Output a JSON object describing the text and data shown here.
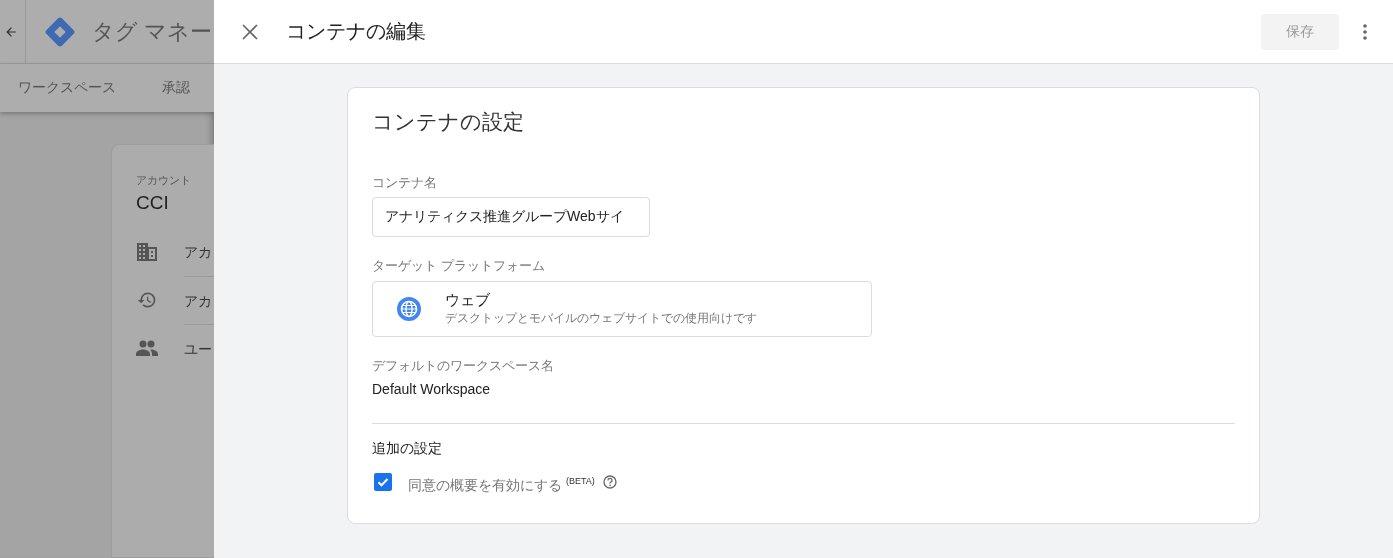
{
  "background": {
    "app_title": "タグ マネー",
    "nav_tabs": [
      {
        "label": "ワークスペース",
        "selected": false
      },
      {
        "label": "承認",
        "selected": false
      }
    ],
    "account": {
      "caption": "アカウント",
      "name": "CCI",
      "items": [
        {
          "kind": "building",
          "label": "アカ"
        },
        {
          "kind": "history",
          "label": "アカ"
        },
        {
          "kind": "people",
          "label": "ユー"
        }
      ]
    }
  },
  "panel": {
    "title": "コンテナの編集",
    "save_button": {
      "label": "保存",
      "disabled": true
    },
    "card": {
      "title": "コンテナの設定",
      "container_name": {
        "label": "コンテナ名",
        "value": "アナリティクス推進グループWebサイ"
      },
      "platform": {
        "label": "ターゲット プラットフォーム",
        "name": "ウェブ",
        "description": "デスクトップとモバイルのウェブサイトでの使用向けです"
      },
      "workspace": {
        "label": "デフォルトのワークスペース名",
        "value": "Default Workspace"
      },
      "additional": {
        "heading": "追加の設定",
        "options": [
          {
            "label": "同意の概要を有効にする $^{(BETA)}$",
            "checked": true
          }
        ]
      }
    }
  }
}
